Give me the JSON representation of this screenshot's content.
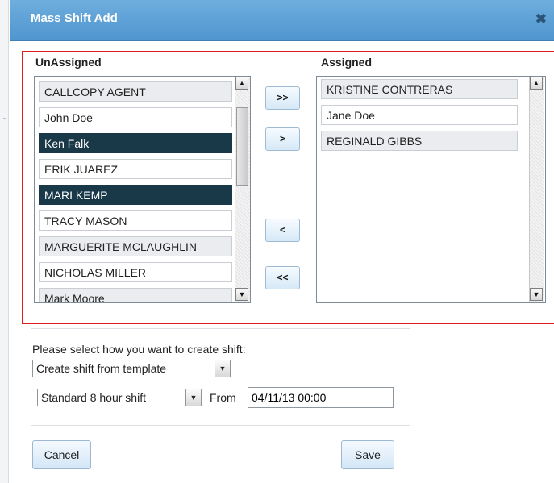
{
  "dialog": {
    "title": "Mass Shift Add",
    "close_glyph": "✖"
  },
  "unassigned": {
    "label": "UnAssigned",
    "items": [
      {
        "name": "CALLCOPY AGENT",
        "selected": false
      },
      {
        "name": "John Doe",
        "selected": false
      },
      {
        "name": "Ken Falk",
        "selected": true
      },
      {
        "name": "ERIK JUAREZ",
        "selected": false
      },
      {
        "name": "MARI KEMP",
        "selected": true
      },
      {
        "name": "TRACY MASON",
        "selected": false
      },
      {
        "name": "MARGUERITE MCLAUGHLIN",
        "selected": false
      },
      {
        "name": "NICHOLAS MILLER",
        "selected": false
      },
      {
        "name": "Mark Moore",
        "selected": false
      }
    ]
  },
  "assigned": {
    "label": "Assigned",
    "items": [
      {
        "name": "KRISTINE CONTRERAS",
        "selected": false
      },
      {
        "name": "Jane Doe",
        "selected": false
      },
      {
        "name": "REGINALD GIBBS",
        "selected": false
      }
    ]
  },
  "move_buttons": {
    "add_all": ">>",
    "add": ">",
    "remove": "<",
    "remove_all": "<<"
  },
  "shift": {
    "prompt": "Please select how you want to create shift:",
    "method_value": "Create shift from template",
    "template_value": "Standard 8 hour shift",
    "from_label": "From",
    "from_value": "04/11/13 00:00"
  },
  "footer": {
    "cancel_label": "Cancel",
    "save_label": "Save"
  },
  "icons": {
    "scroll_up": "▲",
    "scroll_down": "▼",
    "dropdown": "▼"
  }
}
